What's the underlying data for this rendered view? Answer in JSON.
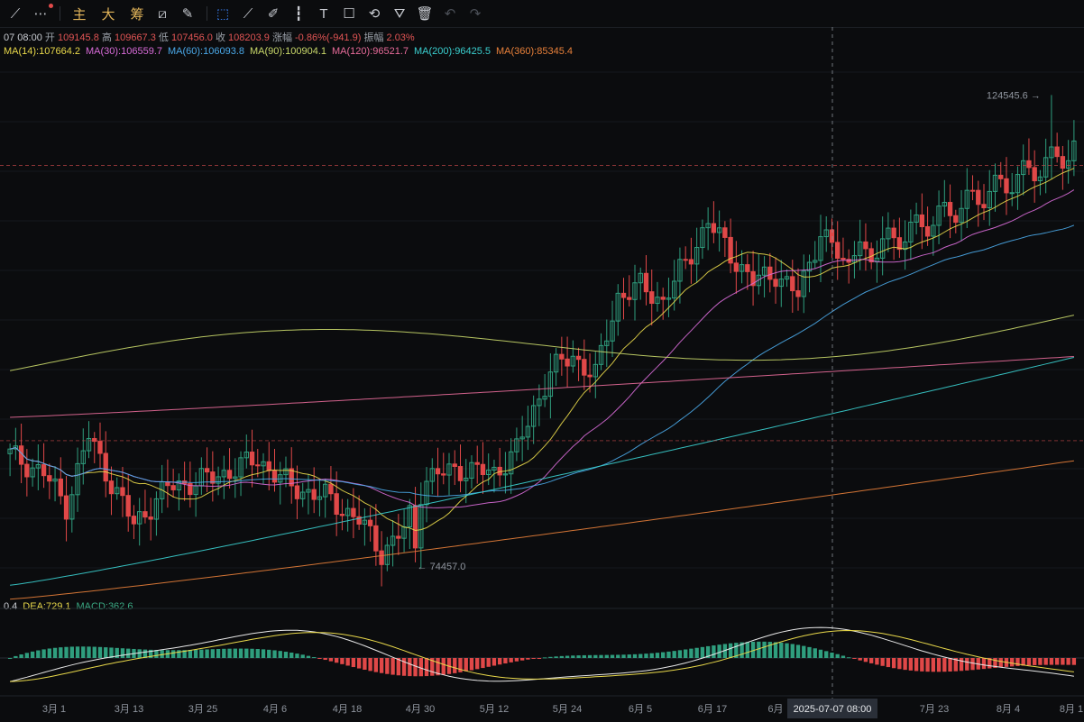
{
  "toolbar": {
    "items": [
      {
        "name": "trend-line-icon",
        "glyph": "⟋"
      },
      {
        "name": "more-icon",
        "glyph": "⋯"
      },
      {
        "name": "main-indicator-button",
        "text": "主"
      },
      {
        "name": "big-button",
        "text": "大"
      },
      {
        "name": "chip-button",
        "text": "筹"
      },
      {
        "name": "ruler-icon",
        "glyph": "⧄"
      },
      {
        "name": "pen-icon",
        "glyph": "✎"
      },
      {
        "name": "select-icon",
        "glyph": "⬚"
      },
      {
        "name": "measure-icon",
        "glyph": "⟋"
      },
      {
        "name": "brush-icon",
        "glyph": "✐"
      },
      {
        "name": "candlestick-icon",
        "glyph": "┇"
      },
      {
        "name": "text-icon",
        "glyph": "T"
      },
      {
        "name": "note-icon",
        "glyph": "☐"
      },
      {
        "name": "magnet-icon",
        "glyph": "⟲"
      },
      {
        "name": "filter-icon",
        "glyph": "⛛"
      },
      {
        "name": "trash-icon",
        "glyph": "🗑"
      },
      {
        "name": "undo-icon",
        "glyph": "↶"
      },
      {
        "name": "redo-icon",
        "glyph": "↷"
      }
    ]
  },
  "ohlc": {
    "date": "07 08:00",
    "open_label": "开",
    "open": "109145.8",
    "high_label": "高",
    "high": "109667.3",
    "low_label": "低",
    "low": "107456.0",
    "close_label": "收",
    "close": "108203.9",
    "change_label": "涨幅",
    "change": "-0.86%(-941.9)",
    "amp_label": "振幅",
    "amp": "2.03%"
  },
  "ma_legend": [
    {
      "text": "MA(14):107664.2",
      "color": "#e8d84a"
    },
    {
      "text": "MA(30):106559.7",
      "color": "#d86bd8"
    },
    {
      "text": "MA(60):106093.8",
      "color": "#4aa8e8"
    },
    {
      "text": "MA(90):100904.1",
      "color": "#c9d86a"
    },
    {
      "text": "MA(120):96521.7",
      "color": "#e86b9a"
    },
    {
      "text": "MA(200):96425.5",
      "color": "#3ad0d0"
    },
    {
      "text": "MA(360):85345.4",
      "color": "#e8803a"
    }
  ],
  "macd_legend": [
    {
      "text": "0.4",
      "color": "#c9ccd2"
    },
    {
      "text": "DEA:729.1",
      "color": "#e8d84a"
    },
    {
      "text": "MACD:362.6",
      "color": "#3aa882"
    }
  ],
  "colors": {
    "up": "#2f9e7e",
    "down": "#e04848",
    "dif": "#e8e8e8",
    "dea": "#e8d84a"
  },
  "chart_data": {
    "type": "candlestick",
    "ylim": [
      70000,
      127000
    ],
    "x_ticks": [
      "3月 1",
      "3月 13",
      "3月 25",
      "4月 6",
      "4月 18",
      "4月 30",
      "5月 12",
      "5月 24",
      "6月 5",
      "6月 17",
      "6月",
      "7月 23",
      "8月 4",
      "8月 1"
    ],
    "crosshair_time": "2025-07-07 08:00",
    "annotations": [
      {
        "text": "124545.6 →",
        "value": 124545.6
      },
      {
        "text": "← 74457.0",
        "value": 74457.0
      }
    ],
    "ma_final": [
      107664.2,
      106559.7,
      106093.8,
      100904.1,
      96521.7,
      96425.5,
      85345.4
    ]
  }
}
